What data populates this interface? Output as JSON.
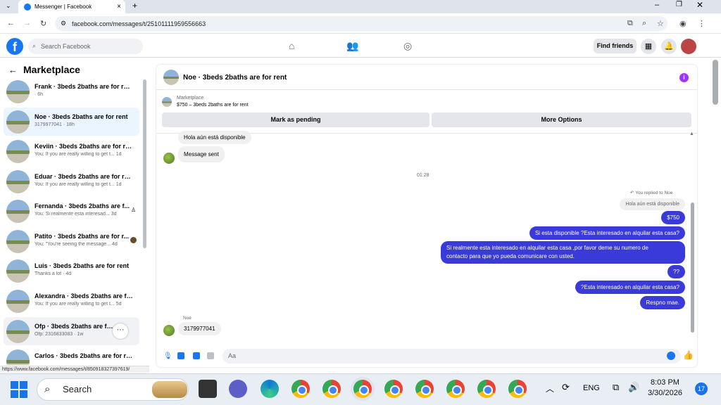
{
  "browser": {
    "tab_title": "Messenger | Facebook",
    "url": "facebook.com/messages/t/25101111959556663",
    "status_url": "https://www.facebook.com/messages/t/850918327397619/"
  },
  "fb_header": {
    "search_placeholder": "Search Facebook",
    "find_friends": "Find friends"
  },
  "sidebar": {
    "title": "Marketplace",
    "conversations": [
      {
        "name": "Frank · 3beds 2baths are for rent",
        "preview": "· 6h"
      },
      {
        "name": "Noe · 3beds 2baths are for rent",
        "preview": "3179977041 · 18h"
      },
      {
        "name": "Keviin · 3beds 2baths are for rent",
        "preview": "You: If you are really willing to get t...  1d"
      },
      {
        "name": "Eduar · 3beds 2baths are for rent",
        "preview": "You: If you are really willing to get t...  1d"
      },
      {
        "name": "Fernanda · 3beds 2baths are f...",
        "preview": "You: Si realmente esta interesad...  3d"
      },
      {
        "name": "Patito · 3beds 2baths are for r...",
        "preview": "You: \"You're seeing the message...  4d"
      },
      {
        "name": "Luis · 3beds 2baths are for rent",
        "preview": "Thanks a lot · 4d"
      },
      {
        "name": "Alexandra · 3beds 2baths are fo...",
        "preview": "You: If you are really willing to get t...  5d"
      },
      {
        "name": "Ofp · 3beds 2baths are for re...",
        "preview": "Ofp: 2316833083 · 1w"
      },
      {
        "name": "Carlos · 3beds 2baths are for rent",
        "preview": ""
      }
    ]
  },
  "chat": {
    "title": "Noe · 3beds 2baths are for rent",
    "marketplace_label": "Marketplace",
    "listing": "$750 – 3beds 2baths are for rent",
    "mark_pending": "Mark as pending",
    "more_options": "More Options",
    "msg_hola": "Hola aún está disponible",
    "msg_sent": "Message sent",
    "timestamp": "01:28",
    "replied_label": "You replied to Noe",
    "reply_quote": "Hola aún está disponible",
    "my_msgs": [
      "$750",
      "Si esta disponible ?Esta interesado en alquilar esta casa?",
      "Si realmente esta interesado en alquilar esta casa ,por favor deme su numero de",
      "contacto para que yo pueda comunicare con usted.",
      "??",
      "?Esta interesado en alquilar esta casa?",
      "Respno mae."
    ],
    "sender_name": "Noe",
    "their_number": "3179977041",
    "composer_placeholder": "Aa"
  },
  "taskbar": {
    "search": "Search",
    "lang": "ENG",
    "time": "8:03 PM",
    "date": "3/30/2026",
    "notif_count": "17"
  }
}
